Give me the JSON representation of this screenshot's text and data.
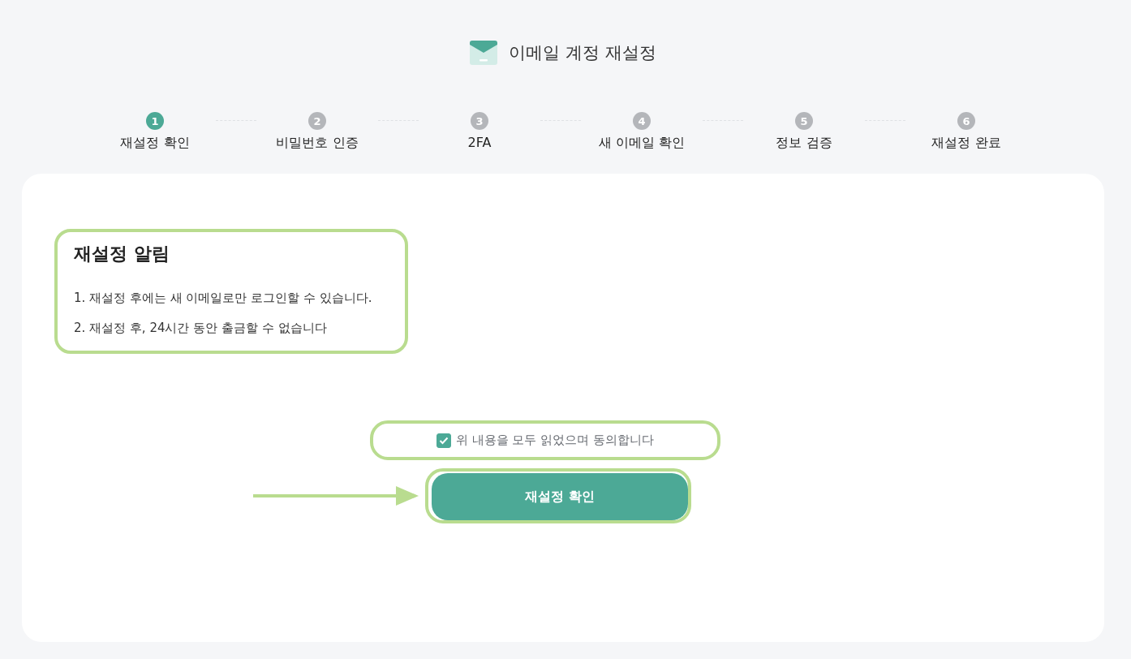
{
  "header": {
    "title": "이메일 계정 재설정"
  },
  "steps": [
    {
      "number": "1",
      "label": "재설정 확인",
      "selected": true
    },
    {
      "number": "2",
      "label": "비밀번호 인증",
      "selected": false
    },
    {
      "number": "3",
      "label": "2FA",
      "selected": false
    },
    {
      "number": "4",
      "label": "새 이메일 확인",
      "selected": false
    },
    {
      "number": "5",
      "label": "정보 검증",
      "selected": false
    },
    {
      "number": "6",
      "label": "재설정 완료",
      "selected": false
    }
  ],
  "notice": {
    "title": "재설정 알림",
    "items": [
      "1. 재설정 후에는 새 이메일로만 로그인할 수 있습니다.",
      "2. 재설정 후, 24시간 동안 출금할 수 없습니다"
    ]
  },
  "agreement": {
    "label": "위 내용을 모두 읽었으며 동의합니다",
    "checked": true
  },
  "confirm_button": {
    "label": "재설정 확인"
  }
}
